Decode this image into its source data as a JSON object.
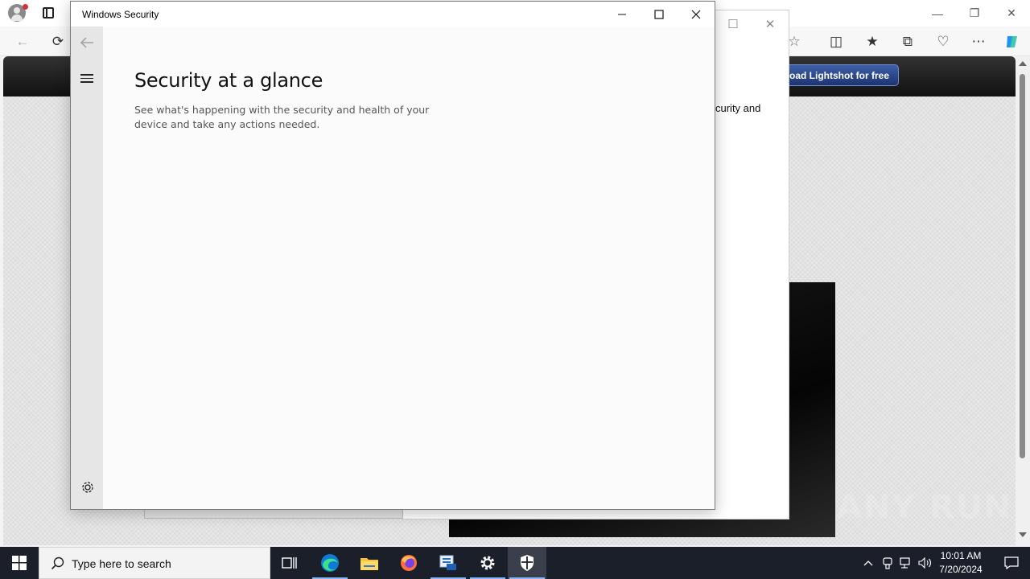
{
  "windows_security": {
    "title": "Windows Security",
    "heading": "Security at a glance",
    "description": "See what's happening with the security and health of your device and take any actions needed.",
    "caption": {
      "minimize": "minimize-icon",
      "maximize": "maximize-icon",
      "close": "close-icon"
    },
    "sidebar": {
      "back": "back-arrow-icon",
      "menu": "hamburger-menu-icon",
      "settings": "gear-icon"
    }
  },
  "behind_dialog": {
    "partial_text": "curity and"
  },
  "browser": {
    "site_button": "load Lightshot for free",
    "toolbar_icons": [
      "back-arrow-icon",
      "refresh-icon",
      "favorite-star-icon",
      "split-screen-icon",
      "favorites-icon",
      "collections-icon",
      "browser-essentials-icon",
      "more-icon",
      "copilot-icon"
    ]
  },
  "taskbar": {
    "search_placeholder": "Type here to search",
    "apps": [
      "task-view-icon",
      "edge-icon",
      "file-explorer-icon",
      "firefox-icon",
      "mail-app-icon",
      "settings-icon",
      "windows-security-icon"
    ],
    "time": "10:01 AM",
    "date": "7/20/2024"
  },
  "watermark": "ANY RUN",
  "colors": {
    "taskbar": "#1b1f2a",
    "sidebar": "#e6e6e6",
    "accent_blue": "#0078d4"
  }
}
